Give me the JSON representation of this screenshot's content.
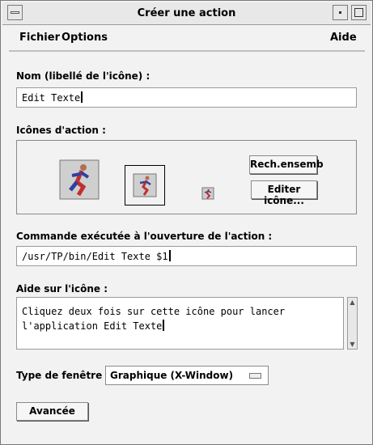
{
  "window": {
    "title": "Créer une action"
  },
  "menu": {
    "fichier": "Fichier",
    "options": "Options",
    "aide": "Aide"
  },
  "name_field": {
    "label": "Nom (libellé de l'icône) :",
    "value": "Edit Texte"
  },
  "icons": {
    "label": "Icônes d'action :",
    "find_set_button": "Rech.ensemb",
    "edit_icon_button": "Editer icône..."
  },
  "command": {
    "label": "Commande exécutée à l'ouverture de l'action :",
    "value": "/usr/TP/bin/Edit Texte $1"
  },
  "help": {
    "label": "Aide sur l'icône :",
    "line1": "Cliquez deux fois sur cette icône pour lancer",
    "line2": "l'application Edit Texte"
  },
  "window_type": {
    "label": "Type de fenêtre :",
    "value": "Graphique (X-Window)"
  },
  "advanced_button": "Avancée"
}
